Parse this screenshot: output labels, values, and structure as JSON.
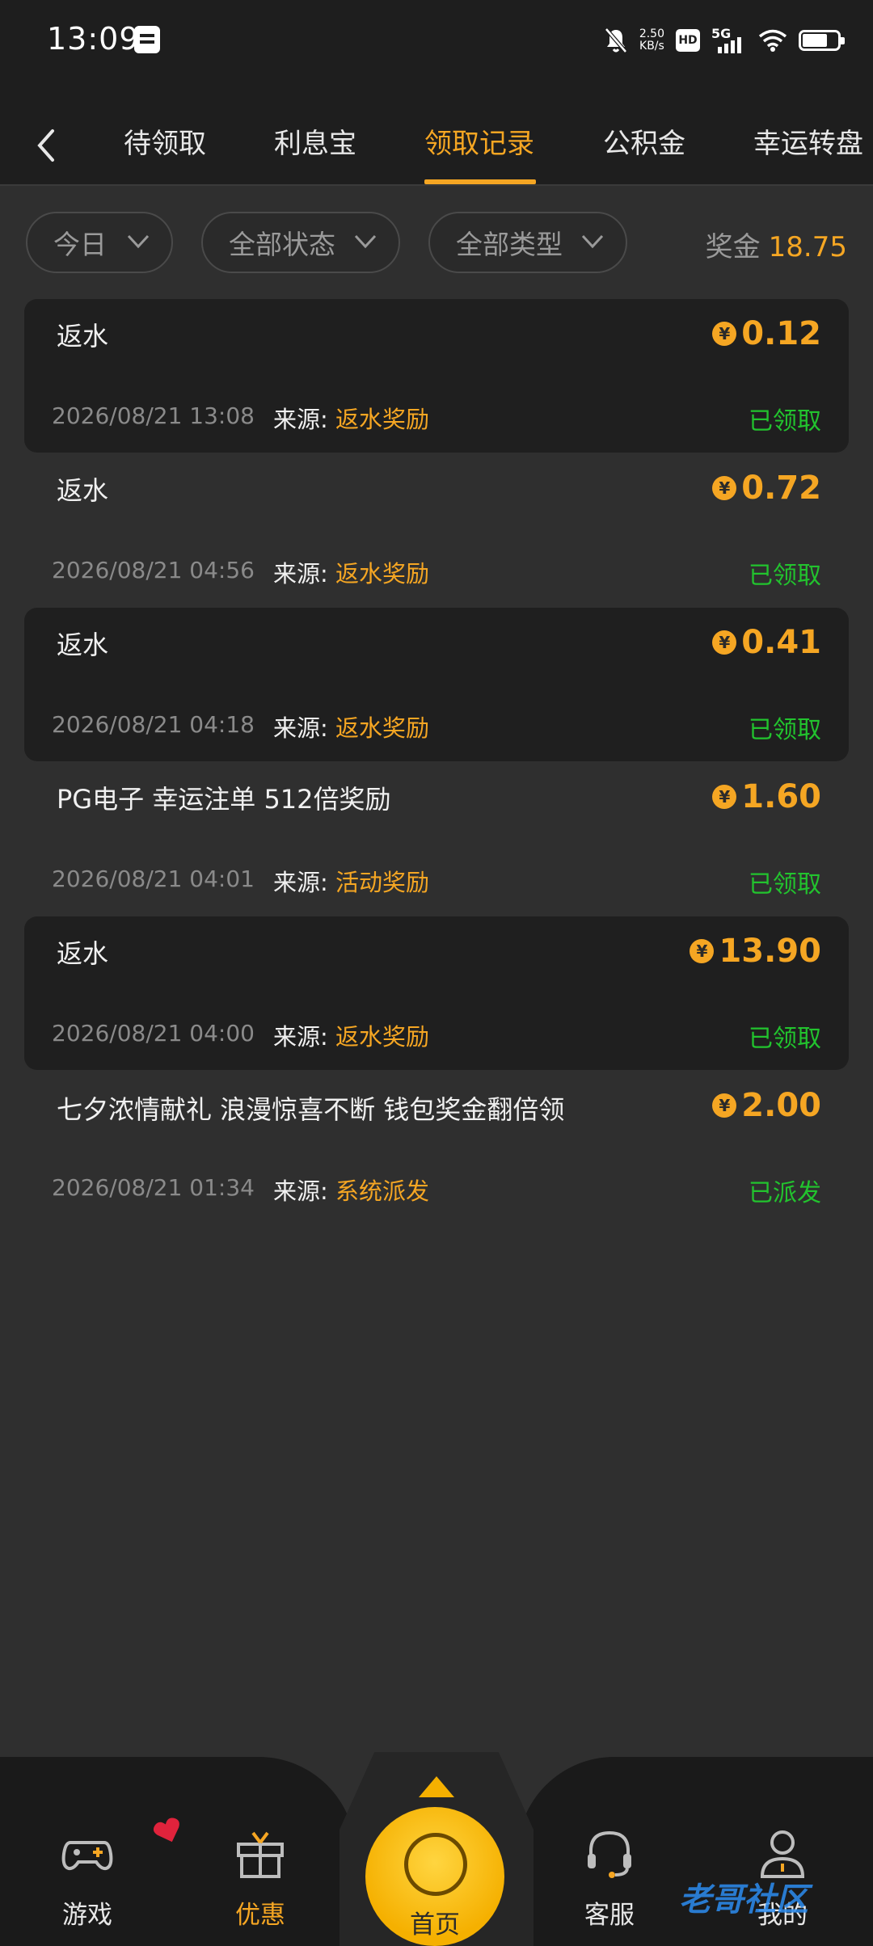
{
  "status_bar": {
    "time": "13:09",
    "net_speed": "2.50",
    "net_unit": "KB/s",
    "hd": "HD",
    "signal": "5G"
  },
  "tabs": [
    {
      "label": "待领取"
    },
    {
      "label": "利息宝"
    },
    {
      "label": "领取记录"
    },
    {
      "label": "公积金"
    },
    {
      "label": "幸运转盘"
    }
  ],
  "filters": {
    "date": "今日",
    "status": "全部状态",
    "type": "全部类型",
    "bonus_label": "奖金",
    "bonus_value": "18.75"
  },
  "source_label": "来源:",
  "records": [
    {
      "title": "返水",
      "amount": "0.12",
      "date": "2026/08/21 13:08",
      "source": "返水奖励",
      "state": "已领取"
    },
    {
      "title": "返水",
      "amount": "0.72",
      "date": "2026/08/21 04:56",
      "source": "返水奖励",
      "state": "已领取"
    },
    {
      "title": "返水",
      "amount": "0.41",
      "date": "2026/08/21 04:18",
      "source": "返水奖励",
      "state": "已领取"
    },
    {
      "title": "PG电子 幸运注单 512倍奖励",
      "amount": "1.60",
      "date": "2026/08/21 04:01",
      "source": "活动奖励",
      "state": "已领取"
    },
    {
      "title": "返水",
      "amount": "13.90",
      "date": "2026/08/21 04:00",
      "source": "返水奖励",
      "state": "已领取"
    },
    {
      "title": "七夕浓情献礼 浪漫惊喜不断 钱包奖金翻倍领",
      "amount": "2.00",
      "date": "2026/08/21 01:34",
      "source": "系统派发",
      "state": "已派发"
    }
  ],
  "bottom_nav": {
    "games": "游戏",
    "promo": "优惠",
    "home": "首页",
    "service": "客服",
    "mine": "我的"
  },
  "watermark": "老哥社区",
  "colors": {
    "accent": "#f5a623",
    "success": "#22c32e",
    "background": "#2f2f2f",
    "card": "#1f1f1f"
  }
}
